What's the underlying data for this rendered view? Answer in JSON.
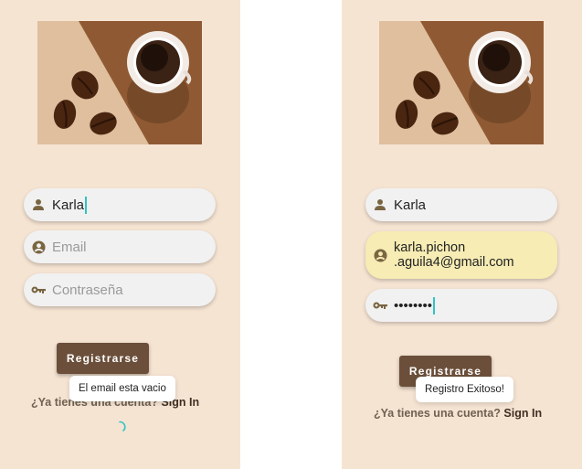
{
  "colors": {
    "background": "#f6e4d3",
    "button": "#6b4f3a",
    "field": "#f1f1f1",
    "autofill": "#f6ecb4",
    "caret": "#2ec4c4",
    "icon": "#7a6542"
  },
  "icons": [
    "coffee-hero-image",
    "person-icon",
    "account-circle-icon",
    "key-icon",
    "spinner-icon"
  ],
  "left_screen": {
    "name_field": {
      "value": "Karla",
      "icon": "person-icon",
      "focused": true
    },
    "email_field": {
      "placeholder": "Email",
      "icon": "account-circle-icon"
    },
    "password_field": {
      "placeholder": "Contraseña",
      "icon": "key-icon"
    },
    "register_button": "Registrarse",
    "signin_prompt": "¿Ya tienes una cuenta?",
    "signin_link": "Sign In",
    "toast": "El email esta vacio"
  },
  "right_screen": {
    "name_field": {
      "value": "Karla",
      "icon": "person-icon"
    },
    "email_field": {
      "value": "karla.pichon\n.aguila4@gmail.com",
      "icon": "account-circle-icon",
      "autofilled": true
    },
    "password_field": {
      "value": "••••••••",
      "icon": "key-icon",
      "focused": true
    },
    "register_button": "Registrarse",
    "signin_prompt": "¿Ya tienes una cuenta?",
    "signin_link": "Sign In",
    "toast": "Registro Exitoso!"
  }
}
